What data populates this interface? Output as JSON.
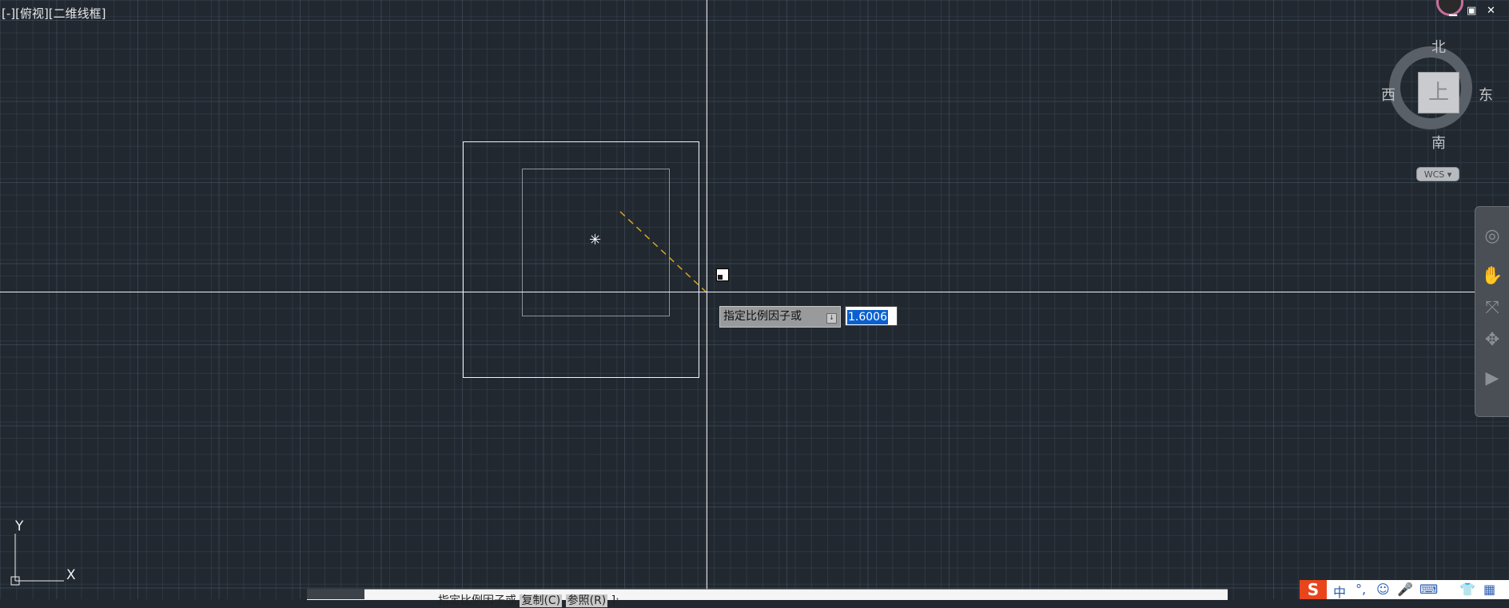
{
  "viewport": {
    "label": "[-][俯视][二维线框]"
  },
  "dynamic_input": {
    "prompt": "指定比例因子或",
    "prompt_icon": "arrow-down-icon",
    "value": "1.6006"
  },
  "viewcube": {
    "north": "北",
    "south": "南",
    "west": "西",
    "east": "东",
    "face": "上",
    "wcs_label": "WCS ▾"
  },
  "ucs_icon": {
    "y_label": "Y",
    "x_label": "X"
  },
  "command_line": {
    "text": "指定比例因子或",
    "option_copy": "复制(C)",
    "option_reference": "参照(R)",
    "suffix": "]:"
  },
  "window_controls": {
    "minimize": "▁",
    "maximize": "▣",
    "close": "✕"
  },
  "ime": {
    "logo": "S",
    "mode": "中",
    "punct": "°,",
    "emoji": "☺",
    "mic": "🎤",
    "keyboard": "⌨",
    "shirt": "👕",
    "grid": "▦"
  },
  "colors": {
    "background": "#212830",
    "rubber_band": "#d9a520",
    "selection": "#0a5fd1"
  }
}
